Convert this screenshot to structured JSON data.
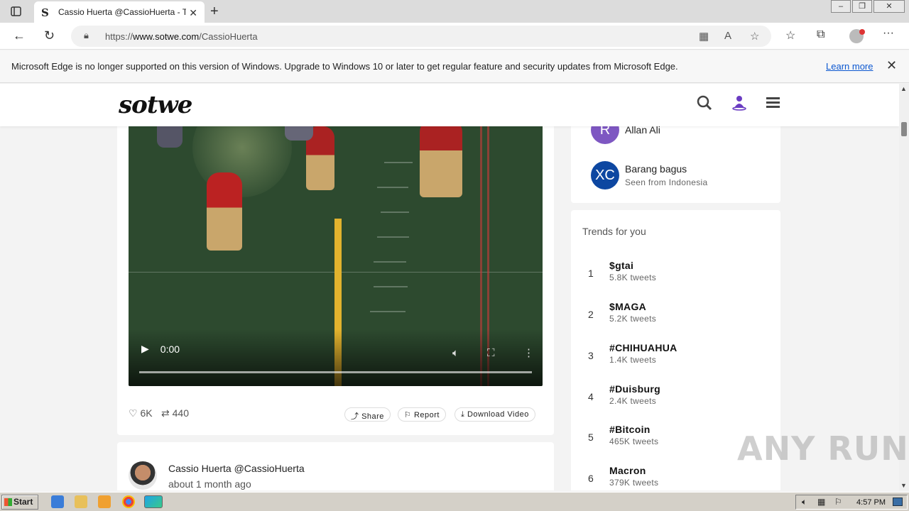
{
  "browser": {
    "tab_title": "Cassio Huerta @CassioHuerta - T",
    "tab_favicon": "S",
    "url_prefix": "https://",
    "url_domain": "www.sotwe.com",
    "url_path": "/CassioHuerta",
    "new_tab": "+",
    "close_tab": "✕"
  },
  "infobar": {
    "message": "Microsoft Edge is no longer supported on this version of Windows. Upgrade to Windows 10 or later to get regular feature and security updates from Microsoft Edge.",
    "learn_more": "Learn more"
  },
  "site": {
    "logo": "sotwe"
  },
  "post": {
    "video_time": "0:00",
    "likes": "6K",
    "retweets": "440",
    "share_label": "Share",
    "report_label": "Report",
    "download_label": "Download Video"
  },
  "reply": {
    "author": "Cassio Huerta @CassioHuerta",
    "time": "about 1 month ago"
  },
  "suggested_users": [
    {
      "initials": "R",
      "name": "Allan Ali",
      "sub": "",
      "color": "#7e57c2"
    },
    {
      "initials": "XC",
      "name": "Barang bagus",
      "sub": "Seen from Indonesia",
      "color": "#0d47a1"
    }
  ],
  "trends": {
    "heading": "Trends for you",
    "items": [
      {
        "rank": "1",
        "tag": "$gtai",
        "count": "5.8K tweets"
      },
      {
        "rank": "2",
        "tag": "$MAGA",
        "count": "5.2K tweets"
      },
      {
        "rank": "3",
        "tag": "#CHIHUAHUA",
        "count": "1.4K tweets"
      },
      {
        "rank": "4",
        "tag": "#Duisburg",
        "count": "2.4K tweets"
      },
      {
        "rank": "5",
        "tag": "#Bitcoin",
        "count": "465K tweets"
      },
      {
        "rank": "6",
        "tag": "Macron",
        "count": "379K tweets"
      }
    ]
  },
  "watermark": "ANY RUN",
  "taskbar": {
    "start": "Start",
    "clock": "4:57 PM"
  }
}
